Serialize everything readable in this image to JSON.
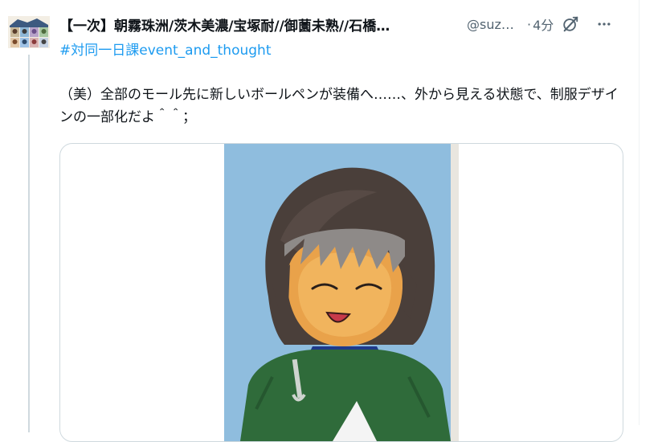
{
  "tweet": {
    "display_name": "【一次】朝霧珠洲/茨木美濃/宝塚耐//御薗未熟//石橋…",
    "handle": "@suz…",
    "dot": "·",
    "time": "4分",
    "hashtag": "#対同一日課event_and_thought",
    "body": "（美）全部のモール先に新しいボールペンが装備へ……、外から見える状態で、制服デザインの一部化だよ＾＾；"
  },
  "icons": {
    "avatar": "avatar-collage",
    "grok": "grok-icon",
    "more": "more-dots-icon"
  },
  "colors": {
    "accent": "#1d9bf0",
    "text": "#0f1419",
    "muted": "#536471",
    "border": "#cfd9de"
  }
}
